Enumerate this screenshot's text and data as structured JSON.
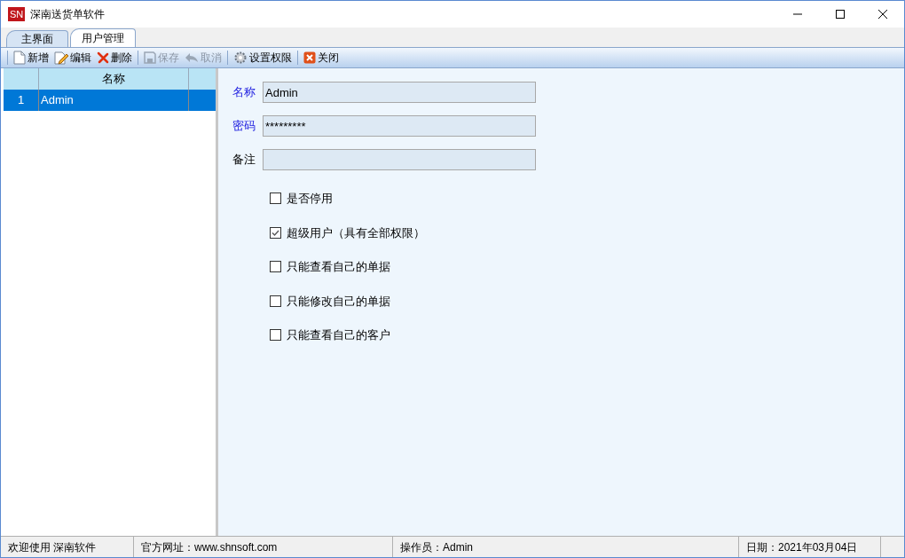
{
  "window": {
    "title": "深南送货单软件",
    "logo": "SN"
  },
  "tabs": [
    {
      "label": "主界面",
      "selected": false
    },
    {
      "label": "用户管理",
      "selected": true
    }
  ],
  "toolbar": {
    "groups": [
      [
        {
          "label": "新增",
          "kind": "page",
          "disabled": false
        },
        {
          "label": "编辑",
          "kind": "edit",
          "disabled": false
        },
        {
          "label": "删除",
          "kind": "delete",
          "disabled": false
        }
      ],
      [
        {
          "label": "保存",
          "kind": "save",
          "disabled": true
        },
        {
          "label": "取消",
          "kind": "undo",
          "disabled": true
        }
      ],
      [
        {
          "label": "设置权限",
          "kind": "gear",
          "disabled": false
        }
      ],
      [
        {
          "label": "关闭",
          "kind": "close",
          "disabled": false
        }
      ]
    ]
  },
  "table": {
    "columns": [
      "名称"
    ],
    "rows": [
      {
        "number": "1",
        "name": "Admin",
        "selected": true
      }
    ]
  },
  "form": {
    "fields": [
      {
        "label": "名称",
        "value": "Admin",
        "required": true
      },
      {
        "label": "密码",
        "value": "*********",
        "required": true
      },
      {
        "label": "备注",
        "required": false
      }
    ],
    "checkboxes": [
      {
        "label": "是否停用",
        "checked": false
      },
      {
        "label": "超级用户（具有全部权限）",
        "checked": true
      },
      {
        "label": "只能查看自己的单据",
        "checked": false
      },
      {
        "label": "只能修改自己的单据",
        "checked": false
      },
      {
        "label": "只能查看自己的客户",
        "checked": false
      }
    ]
  },
  "status_bar": [
    {
      "text": "欢迎使用 深南软件"
    },
    {
      "text": "官方网址：www.shnsoft.com"
    },
    {
      "text": "操作员：Admin"
    },
    {
      "text": "日期：2021年03月04日"
    }
  ]
}
